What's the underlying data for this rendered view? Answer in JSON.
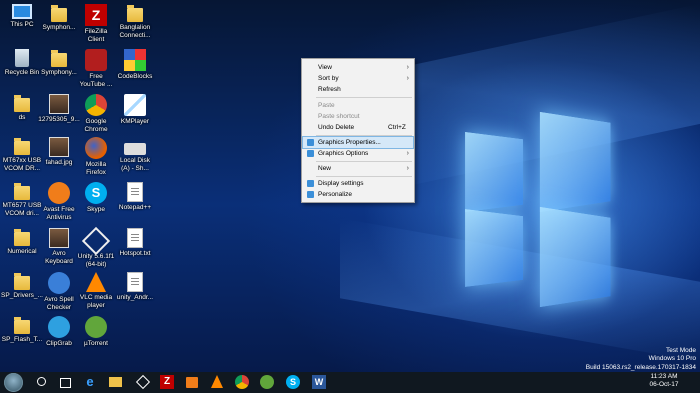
{
  "desktop_icons": [
    {
      "id": "this-pc",
      "label": "This PC",
      "kind": "monitor"
    },
    {
      "id": "recycle-bin",
      "label": "Recycle Bin",
      "kind": "bin"
    },
    {
      "id": "ds",
      "label": "ds",
      "kind": "folder"
    },
    {
      "id": "mt67xx",
      "label": "MT67xx USB\nVCOM DR...",
      "kind": "folder"
    },
    {
      "id": "mt6577",
      "label": "MT6577 USB\nVCOM dri...",
      "kind": "folder"
    },
    {
      "id": "numerical",
      "label": "Numerical",
      "kind": "folder"
    },
    {
      "id": "sp-drivers",
      "label": "SP_Drivers_...",
      "kind": "folder"
    },
    {
      "id": "sp-flash",
      "label": "SP_Flash_T...",
      "kind": "folder"
    },
    {
      "id": "symphon1",
      "label": "Symphon...",
      "kind": "folder"
    },
    {
      "id": "symphony",
      "label": "Symphony...",
      "kind": "folder"
    },
    {
      "id": "img12795305",
      "label": "12795305_9...",
      "kind": "photo"
    },
    {
      "id": "fahad",
      "label": "fahad.jpg",
      "kind": "photo"
    },
    {
      "id": "avast",
      "label": "Avast Free\nAntivirus",
      "kind": "avast"
    },
    {
      "id": "avro-keyboard",
      "label": "Avro\nKeyboard",
      "kind": "photo"
    },
    {
      "id": "avro-spell",
      "label": "Avro Spell\nChecker",
      "kind": "pen"
    },
    {
      "id": "clipgrab",
      "label": "ClipGrab",
      "kind": "clipgrab"
    },
    {
      "id": "filezilla",
      "label": "FileZilla\nClient",
      "kind": "filezilla"
    },
    {
      "id": "free-youtube",
      "label": "Free\nYouTube ...",
      "kind": "youtube"
    },
    {
      "id": "chrome",
      "label": "Google\nChrome",
      "kind": "chrome"
    },
    {
      "id": "firefox",
      "label": "Mozilla\nFirefox",
      "kind": "firefox"
    },
    {
      "id": "skype",
      "label": "Skype",
      "kind": "skype"
    },
    {
      "id": "unity",
      "label": "Unity 5.6.1f1\n(64-bit)",
      "kind": "unity"
    },
    {
      "id": "vlc",
      "label": "VLC media\nplayer",
      "kind": "vlc"
    },
    {
      "id": "utorrent",
      "label": "µTorrent",
      "kind": "utorrent"
    },
    {
      "id": "banglalion",
      "label": "Banglalion\nConnecti...",
      "kind": "folder"
    },
    {
      "id": "codeblocks",
      "label": "CodeBlocks",
      "kind": "codeblocks"
    },
    {
      "id": "kmplayer",
      "label": "KMPlayer",
      "kind": "kmplayer"
    },
    {
      "id": "local-disk",
      "label": "Local Disk\n(A) - Sh...",
      "kind": "disk"
    },
    {
      "id": "notepadpp",
      "label": "Notepad++",
      "kind": "doc"
    },
    {
      "id": "hotspot",
      "label": "Hotspot.txt",
      "kind": "doc"
    },
    {
      "id": "unity-andr",
      "label": "unity_Andr...",
      "kind": "doc"
    }
  ],
  "context_menu": {
    "items": [
      {
        "label": "View",
        "submenu": true,
        "disabled": false
      },
      {
        "label": "Sort by",
        "submenu": true,
        "disabled": false
      },
      {
        "label": "Refresh",
        "submenu": false,
        "disabled": false
      },
      {
        "label": "Paste",
        "submenu": false,
        "disabled": true
      },
      {
        "label": "Paste shortcut",
        "submenu": false,
        "disabled": true
      },
      {
        "label": "Undo Delete",
        "shortcut": "Ctrl+Z",
        "submenu": false,
        "disabled": false
      },
      {
        "label": "Graphics Properties...",
        "submenu": false,
        "disabled": false,
        "icon": "intel-graphics-icon",
        "highlighted": true
      },
      {
        "label": "Graphics Options",
        "submenu": true,
        "disabled": false,
        "icon": "intel-graphics-icon"
      },
      {
        "label": "New",
        "submenu": true,
        "disabled": false
      },
      {
        "label": "Display settings",
        "submenu": false,
        "disabled": false,
        "icon": "display-icon"
      },
      {
        "label": "Personalize",
        "submenu": false,
        "disabled": false,
        "icon": "personalize-icon"
      }
    ]
  },
  "watermark": {
    "line1": "Test Mode",
    "line2": "Windows 10 Pro",
    "line3": "Build 15063.rs2_release.170317-1834"
  },
  "taskbar": {
    "time": "11:23 AM",
    "date": "06-Oct-17",
    "pinned": [
      "search-icon",
      "task-view-icon",
      "edge-icon",
      "file-explorer-icon",
      "unity-icon",
      "filezilla-icon",
      "vlc-icon",
      "chrome-icon",
      "utorrent-icon",
      "skype-icon",
      "word-icon"
    ]
  },
  "colors": {
    "accent": "#0078d7",
    "taskbar": "#101820",
    "menu_highlight": "#d5e8f8"
  }
}
